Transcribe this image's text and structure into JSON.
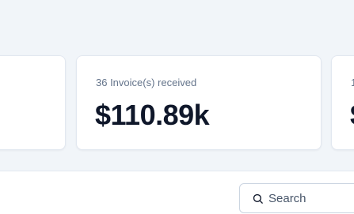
{
  "stats": {
    "cards": [
      {
        "label": "",
        "value": ""
      },
      {
        "label": "36 Invoice(s) received",
        "value": "$110.89k"
      },
      {
        "label": "1",
        "value": "$"
      }
    ]
  },
  "toolbar": {
    "search": {
      "placeholder": "Search",
      "value": ""
    }
  },
  "colors": {
    "background": "#f1f5f9",
    "card": "#ffffff",
    "border": "#e2e8f0",
    "label_text": "#64748b",
    "value_text": "#0f172a"
  }
}
